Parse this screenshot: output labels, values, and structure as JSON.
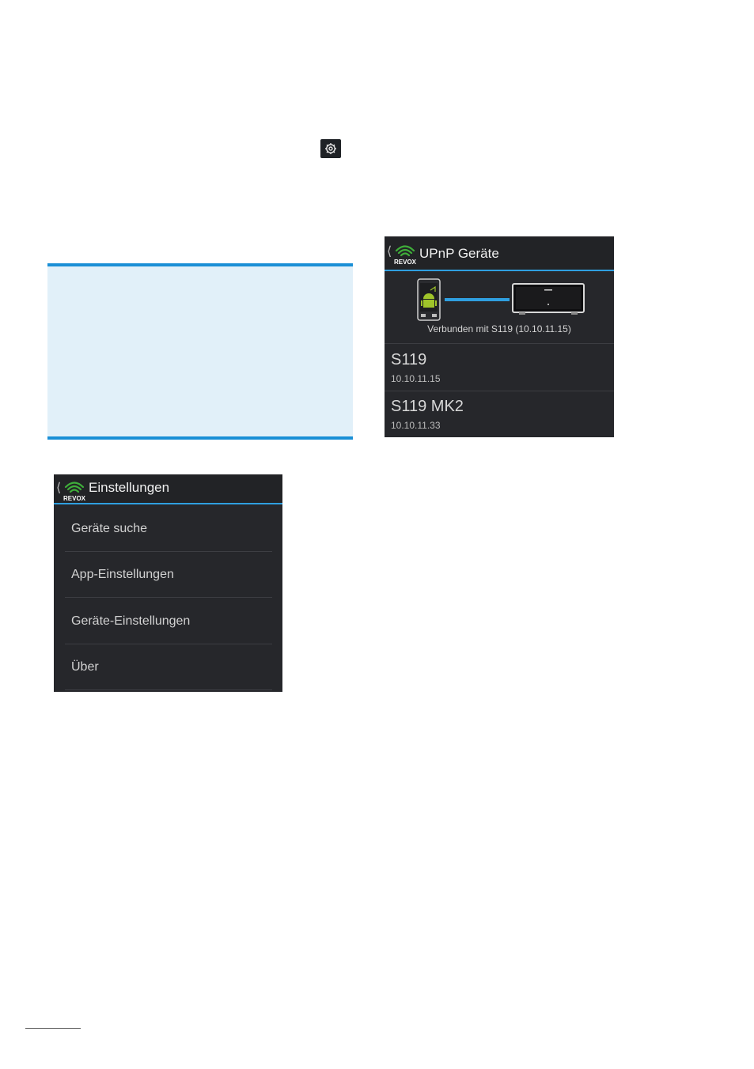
{
  "icons": {
    "gear": "gear-icon",
    "back": "chevron-left-icon",
    "logo": "revox-logo",
    "phone": "android-phone-icon",
    "receiver": "receiver-icon"
  },
  "logo": {
    "text": "REVOX"
  },
  "colors": {
    "accent": "#2f9fe0",
    "note_border": "#1a8fd6",
    "note_bg": "#e1f0f9",
    "screen_bg": "#26272b",
    "logo_green": "#3fae3a"
  },
  "upnp": {
    "title": "UPnP Geräte",
    "status": "Verbunden mit S119 (10.10.11.15)",
    "devices": [
      {
        "name": "S119",
        "ip": "10.10.11.15"
      },
      {
        "name": "S119 MK2",
        "ip": "10.10.11.33"
      }
    ]
  },
  "settings": {
    "title": "Einstellungen",
    "items": [
      {
        "label": "Geräte suche"
      },
      {
        "label": "App-Einstellungen"
      },
      {
        "label": "Geräte-Einstellungen"
      },
      {
        "label": "Über"
      }
    ]
  }
}
